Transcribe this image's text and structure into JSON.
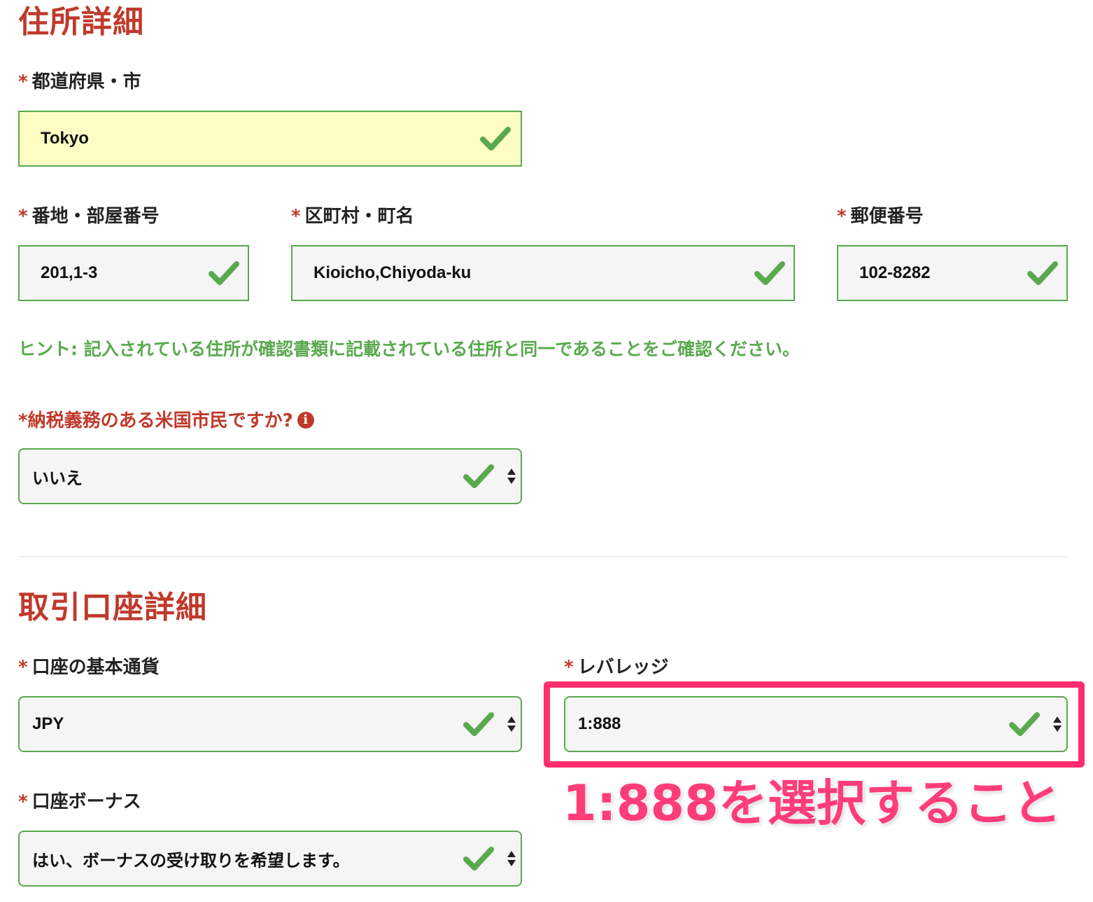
{
  "address_section": {
    "title": "住所詳細",
    "prefecture_city": {
      "label": "都道府県・市",
      "value": "Tokyo"
    },
    "street_room": {
      "label": "番地・部屋番号",
      "value": "201,1-3"
    },
    "ward_town": {
      "label": "区町村・町名",
      "value": "Kioicho,Chiyoda-ku"
    },
    "postal_code": {
      "label": "郵便番号",
      "value": "102-8282"
    },
    "hint": "ヒント: 記入されている住所が確認書類に記載されている住所と同一であることをご確認ください。",
    "us_taxpayer": {
      "label": "*納税義務のある米国市民ですか?",
      "value": "いいえ"
    }
  },
  "trading_section": {
    "title": "取引口座詳細",
    "base_currency": {
      "label": "口座の基本通貨",
      "value": "JPY"
    },
    "leverage": {
      "label": "レバレッジ",
      "value": "1:888"
    },
    "bonus": {
      "label": "口座ボーナス",
      "value": "はい、ボーナスの受け取りを希望します。"
    }
  },
  "annotation": {
    "text": "1:888を選択すること"
  },
  "required_marker": "*",
  "icons": {
    "check": "check-icon",
    "select_arrows": "select-arrows-icon",
    "info": "info-icon"
  },
  "colors": {
    "section_title": "#c0392b",
    "valid_border": "#5aa94f",
    "hint_text": "#5aa94f",
    "highlight": "#ff2d6e",
    "annotation": "#ff3d78",
    "autofill_bg": "#fdfdc3"
  }
}
